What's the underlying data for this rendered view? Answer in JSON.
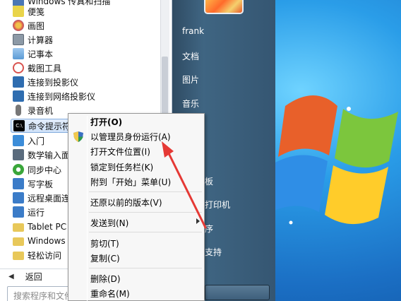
{
  "start_menu": {
    "programs": [
      {
        "label": "Windows 传真和扫描",
        "icon": "fax-icon",
        "color": "#4a77b5"
      },
      {
        "label": "便笺",
        "icon": "sticky-note-icon",
        "color": "#e9d44a"
      },
      {
        "label": "画图",
        "icon": "paint-icon",
        "color": "#d9534f"
      },
      {
        "label": "计算器",
        "icon": "calculator-icon",
        "color": "#6c7a89"
      },
      {
        "label": "记事本",
        "icon": "notepad-icon",
        "color": "#5b9bd5"
      },
      {
        "label": "截图工具",
        "icon": "snipping-tool-icon",
        "color": "#d9534f"
      },
      {
        "label": "连接到投影仪",
        "icon": "projector-icon",
        "color": "#2f6db0"
      },
      {
        "label": "连接到网络投影仪",
        "icon": "network-projector-icon",
        "color": "#2f6db0"
      },
      {
        "label": "录音机",
        "icon": "microphone-icon",
        "color": "#666666"
      },
      {
        "label": "命令提示符",
        "icon": "command-prompt-icon",
        "color": "#000000"
      },
      {
        "label": "入门",
        "icon": "getting-started-icon",
        "color": "#3c8dd9"
      },
      {
        "label": "数学输入面板",
        "icon": "math-input-icon",
        "color": "#5a6b7d"
      },
      {
        "label": "同步中心",
        "icon": "sync-center-icon",
        "color": "#3aa63a"
      },
      {
        "label": "写字板",
        "icon": "wordpad-icon",
        "color": "#3b7cc8"
      },
      {
        "label": "远程桌面连接",
        "icon": "remote-desktop-icon",
        "color": "#3b7cc8"
      },
      {
        "label": "运行",
        "icon": "run-icon",
        "color": "#3b7cc8"
      },
      {
        "label": "Tablet PC",
        "icon": "folder-icon",
        "color": "#e8c85a"
      },
      {
        "label": "Windows",
        "icon": "folder-icon",
        "color": "#e8c85a"
      },
      {
        "label": "轻松访问",
        "icon": "folder-icon",
        "color": "#e8c85a"
      }
    ],
    "back_label": "返回",
    "search_placeholder": "搜索程序和文件"
  },
  "right_panel": {
    "links": [
      "frank",
      "文档",
      "图片",
      "音乐",
      "板",
      "打印机",
      "序",
      "支持"
    ]
  },
  "context_menu": {
    "items": [
      "打开(O)",
      "以管理员身份运行(A)",
      "打开文件位置(I)",
      "锁定到任务栏(K)",
      "附到「开始」菜单(U)",
      "还原以前的版本(V)",
      "发送到(N)",
      "剪切(T)",
      "复制(C)",
      "删除(D)",
      "重命名(M)"
    ]
  },
  "colors": {
    "annotation_arrow": "#e53935",
    "desktop_blue": "#1b6fc4",
    "menu_panel_dark": "#3f6582"
  }
}
